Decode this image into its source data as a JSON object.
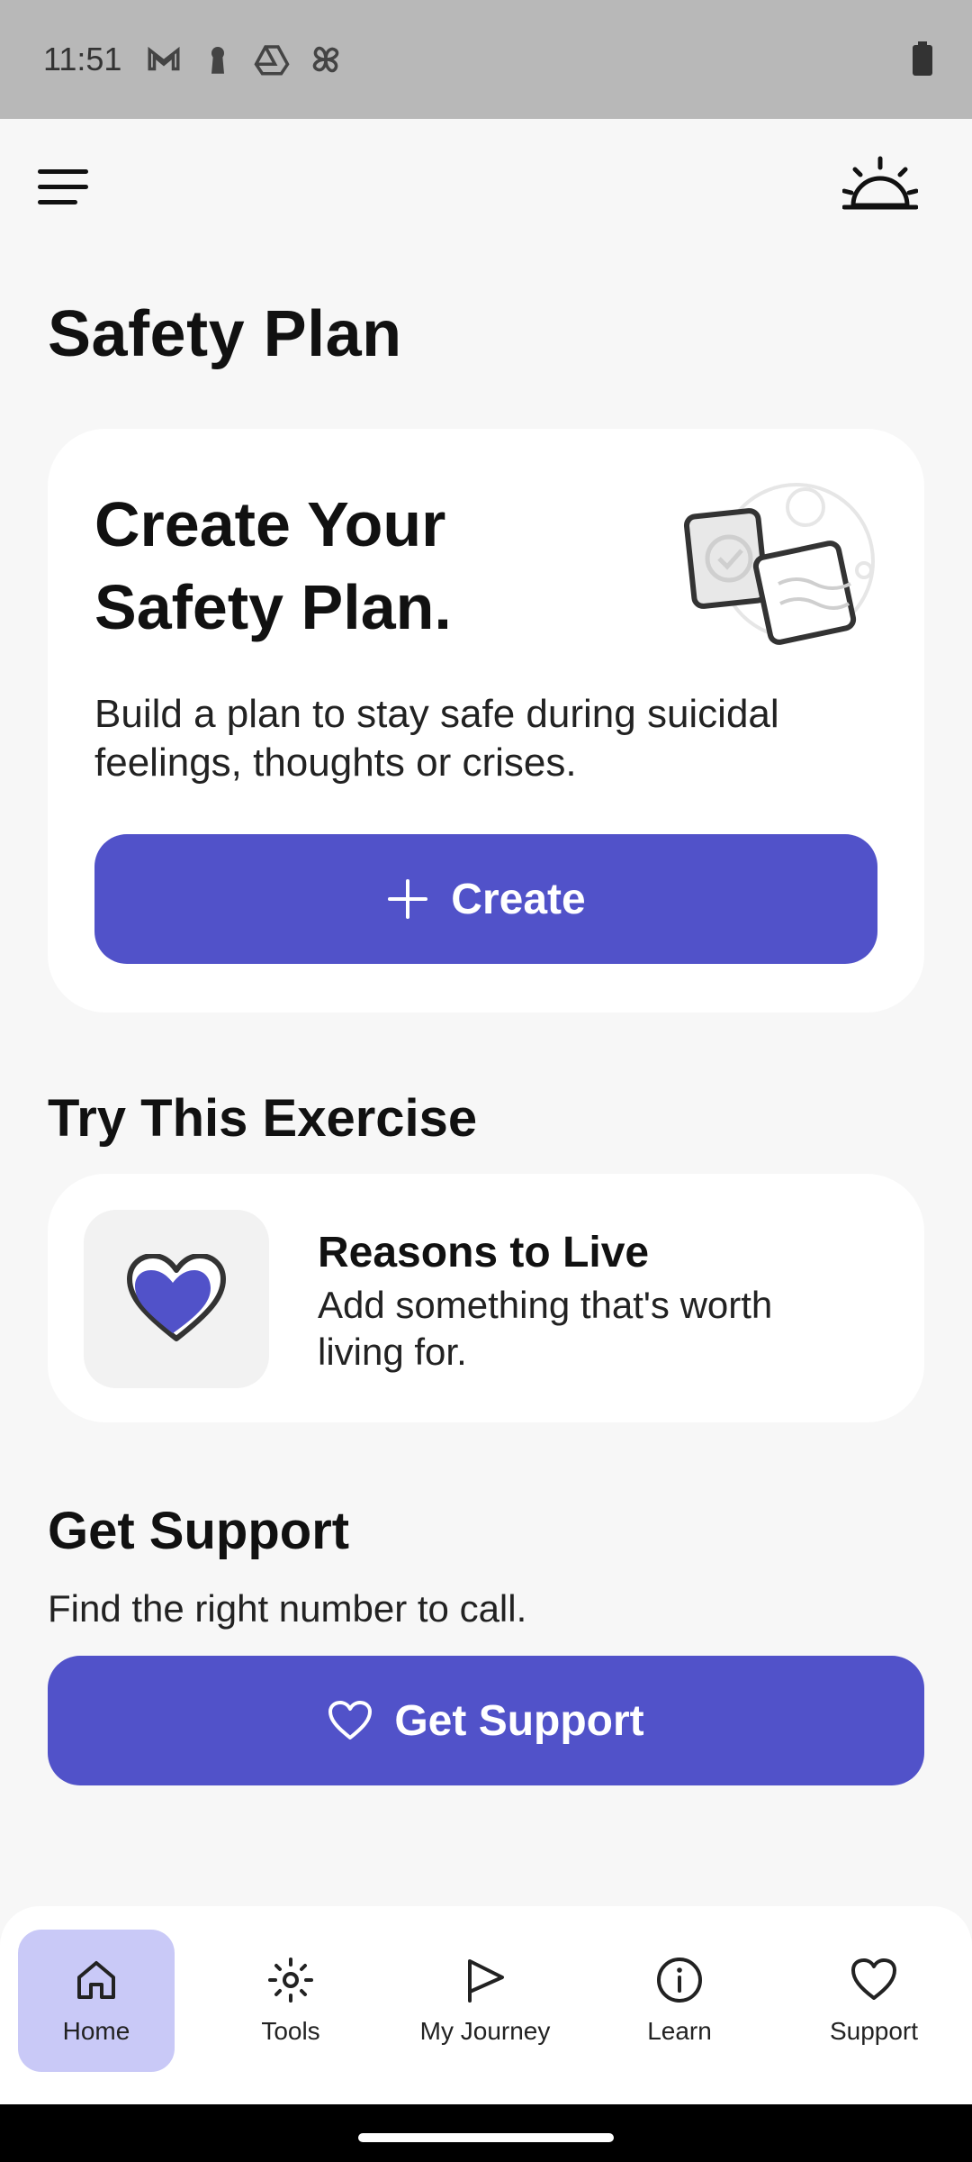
{
  "status_bar": {
    "time": "11:51"
  },
  "page": {
    "title": "Safety Plan"
  },
  "create_card": {
    "heading_line1": "Create Your",
    "heading_line2": "Safety Plan.",
    "description": "Build a plan to stay safe during suicidal feelings, thoughts or crises.",
    "button_label": "Create"
  },
  "exercise_section": {
    "title": "Try This Exercise",
    "card": {
      "title": "Reasons to Live",
      "description": "Add something that's worth living for."
    }
  },
  "support_section": {
    "title": "Get Support",
    "description": "Find the right number to call.",
    "button_label": "Get Support"
  },
  "bottom_nav": {
    "items": [
      {
        "label": "Home",
        "icon": "home-icon",
        "active": true
      },
      {
        "label": "Tools",
        "icon": "sun-icon",
        "active": false
      },
      {
        "label": "My Journey",
        "icon": "flag-icon",
        "active": false
      },
      {
        "label": "Learn",
        "icon": "info-icon",
        "active": false
      },
      {
        "label": "Support",
        "icon": "heart-icon",
        "active": false
      }
    ]
  },
  "colors": {
    "accent": "#5152c9",
    "active_nav": "#c9c9f7",
    "background": "#f7f7f7"
  }
}
